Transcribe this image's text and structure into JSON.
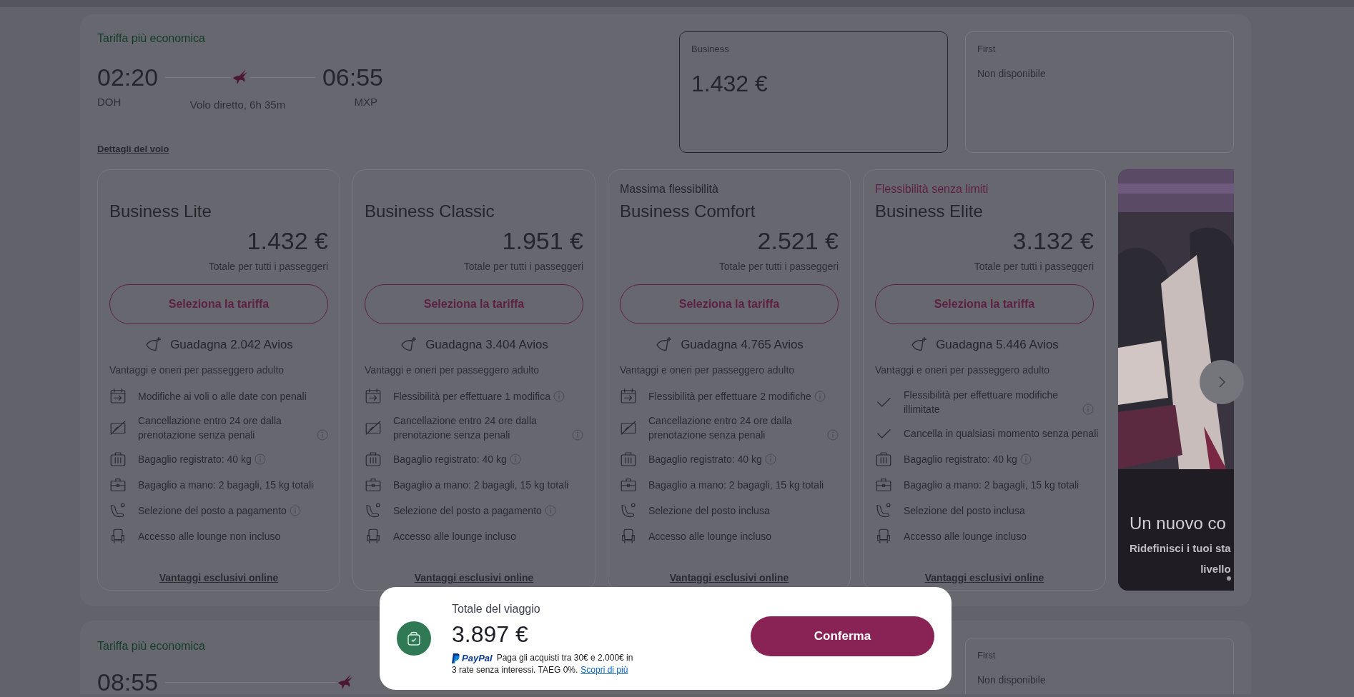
{
  "flight": {
    "cheapest_label": "Tariffa più economica",
    "departure_time": "02:20",
    "departure_airport": "DOH",
    "arrival_time": "06:55",
    "arrival_airport": "MXP",
    "duration": "Volo diretto, 6h 35m",
    "details_link": "Dettagli del volo",
    "cabins": [
      {
        "name": "Business",
        "price": "1.432 €",
        "selected": true,
        "kind": "price"
      },
      {
        "name": "First",
        "price": "Non disponibile",
        "selected": false,
        "kind": "unavailable"
      }
    ],
    "fares": [
      {
        "name": "Business Lite",
        "price": "1.432 €",
        "price_note": "Totale per tutti i passeggeri",
        "select_button": "Seleziona la tariffa",
        "avios": "Guadagna 2.042 Avios",
        "benefits_heading": "Vantaggi e oneri per passeggero adulto",
        "online_link": "Vantaggi esclusivi online",
        "features": [
          {
            "kind": "calendar",
            "text": "Modifiche ai voli o alle date con penali",
            "info": false
          },
          {
            "kind": "cancel",
            "text": "Cancellazione entro 24 ore dalla prenotazione senza penali",
            "info": true
          },
          {
            "kind": "suitcase",
            "text": "Bagaglio registrato: 40 kg",
            "info": true
          },
          {
            "kind": "briefcase",
            "text": "Bagaglio a mano: 2 bagagli, 15 kg totali",
            "info": false
          },
          {
            "kind": "seat",
            "text": "Selezione del posto a pagamento",
            "info": true
          },
          {
            "kind": "lounge",
            "text": "Accesso alle lounge non incluso",
            "info": false
          }
        ]
      },
      {
        "name": "Business Classic",
        "price": "1.951 €",
        "price_note": "Totale per tutti i passeggeri",
        "select_button": "Seleziona la tariffa",
        "avios": "Guadagna 3.404 Avios",
        "benefits_heading": "Vantaggi e oneri per passeggero adulto",
        "online_link": "Vantaggi esclusivi online",
        "features": [
          {
            "kind": "calendar",
            "text": "Flessibilità per effettuare 1 modifica",
            "info": true
          },
          {
            "kind": "cancel",
            "text": "Cancellazione entro 24 ore dalla prenotazione senza penali",
            "info": true
          },
          {
            "kind": "suitcase",
            "text": "Bagaglio registrato: 40 kg",
            "info": true
          },
          {
            "kind": "briefcase",
            "text": "Bagaglio a mano: 2 bagagli, 15 kg totali",
            "info": false
          },
          {
            "kind": "seat",
            "text": "Selezione del posto a pagamento",
            "info": true
          },
          {
            "kind": "lounge",
            "text": "Accesso alle lounge incluso",
            "info": false
          }
        ]
      },
      {
        "tag": "Massima flessibilità",
        "tag_highlight": false,
        "name": "Business Comfort",
        "price": "2.521 €",
        "price_note": "Totale per tutti i passeggeri",
        "select_button": "Seleziona la tariffa",
        "avios": "Guadagna 4.765 Avios",
        "benefits_heading": "Vantaggi e oneri per passeggero adulto",
        "online_link": "Vantaggi esclusivi online",
        "features": [
          {
            "kind": "calendar",
            "text": "Flessibilità per effettuare 2 modifiche",
            "info": true
          },
          {
            "kind": "cancel",
            "text": "Cancellazione entro 24 ore dalla prenotazione senza penali",
            "info": true
          },
          {
            "kind": "suitcase",
            "text": "Bagaglio registrato: 40 kg",
            "info": true
          },
          {
            "kind": "briefcase",
            "text": "Bagaglio a mano: 2 bagagli, 15 kg totali",
            "info": false
          },
          {
            "kind": "seat",
            "text": "Selezione del posto inclusa",
            "info": false
          },
          {
            "kind": "lounge",
            "text": "Accesso alle lounge incluso",
            "info": false
          }
        ]
      },
      {
        "tag": "Flessibilità senza limiti",
        "tag_highlight": true,
        "name": "Business Elite",
        "price": "3.132 €",
        "price_note": "Totale per tutti i passeggeri",
        "select_button": "Seleziona la tariffa",
        "avios": "Guadagna 5.446 Avios",
        "benefits_heading": "Vantaggi e oneri per passeggero adulto",
        "online_link": "Vantaggi esclusivi online",
        "features": [
          {
            "kind": "check",
            "text": "Flessibilità per effettuare modifiche illimitate",
            "info": true
          },
          {
            "kind": "check",
            "text": "Cancella in qualsiasi momento senza penali",
            "info": false
          },
          {
            "kind": "suitcase",
            "text": "Bagaglio registrato: 40 kg",
            "info": true
          },
          {
            "kind": "briefcase",
            "text": "Bagaglio a mano: 2 bagagli, 15 kg totali",
            "info": false
          },
          {
            "kind": "seat",
            "text": "Selezione del posto inclusa",
            "info": false
          },
          {
            "kind": "lounge",
            "text": "Accesso alle lounge incluso",
            "info": false
          }
        ]
      }
    ],
    "promo": {
      "kind": "picture",
      "title": "Un nuovo co",
      "subtitle_lines": [
        "Ridefinisci i tuoi sta",
        "livello"
      ]
    }
  },
  "next_flight": {
    "cheapest_label": "Tariffa più economica",
    "departure_time": "08:55",
    "cabins": [
      {
        "name": "First",
        "price": "Non disponibile",
        "selected": false,
        "kind": "unavailable"
      }
    ]
  },
  "trip_total": {
    "label": "Totale del viaggio",
    "amount": "3.897 €",
    "paypal_logo": "PayPal",
    "paypal_text_lines": [
      "Paga gli acquisti tra 30€ e 2.000€ in",
      "3 rate senza interessi. TAEG 0%."
    ],
    "paypal_link": "Scopri di più",
    "confirm_button": "Conferma"
  }
}
